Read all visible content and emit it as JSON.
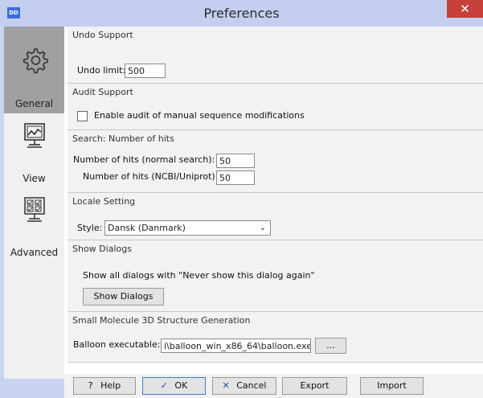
{
  "window": {
    "title": "Preferences",
    "app_icon_text": "DD",
    "close_glyph": "✕"
  },
  "sidebar": {
    "items": [
      {
        "label": "General",
        "icon": "gear-icon",
        "selected": true
      },
      {
        "label": "View",
        "icon": "chart-monitor-icon",
        "selected": false
      },
      {
        "label": "Advanced",
        "icon": "checklist-monitor-icon",
        "selected": false
      }
    ]
  },
  "sections": {
    "undo": {
      "title": "Undo Support",
      "limit_label": "Undo limit:",
      "limit_value": "500"
    },
    "audit": {
      "title": "Audit Support",
      "checkbox_label": "Enable audit of manual sequence modifications",
      "checked": false
    },
    "hits": {
      "title": "Search: Number of hits",
      "normal_label": "Number of hits (normal search):",
      "normal_value": "50",
      "ncbi_label": "Number of hits (NCBI/Uniprot):",
      "ncbi_value": "50"
    },
    "locale": {
      "title": "Locale Setting",
      "style_label": "Style:",
      "style_value": "Dansk (Danmark)"
    },
    "dialogs": {
      "title": "Show Dialogs",
      "description": "Show all dialogs with \"Never show this dialog again\"",
      "button_label": "Show Dialogs"
    },
    "molecule": {
      "title": "Small Molecule 3D Structure Generation",
      "exe_label": "Balloon executable:",
      "exe_value": "i\\balloon_win_x86_64\\balloon.exe",
      "browse_label": "..."
    }
  },
  "footer": {
    "help_label": "Help",
    "help_glyph": "?",
    "ok_label": "OK",
    "ok_glyph": "✓",
    "cancel_label": "Cancel",
    "cancel_glyph": "✕",
    "export_label": "Export",
    "import_label": "Import"
  },
  "colors": {
    "title_bar": "#c4cff0",
    "close": "#c7403a",
    "selected_nav": "#a0a0a0",
    "ok_border": "#3c7fd1"
  }
}
